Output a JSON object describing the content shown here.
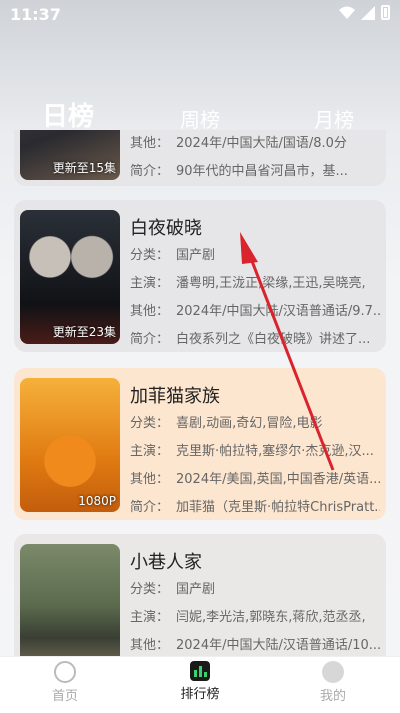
{
  "status": {
    "time": "11:37"
  },
  "tabs": [
    {
      "label": "日榜",
      "active": true
    },
    {
      "label": "周榜",
      "active": false
    },
    {
      "label": "月榜",
      "active": false
    }
  ],
  "cards": [
    {
      "title": "",
      "badge": "更新至15集",
      "rows": [
        {
          "k": "其他：",
          "v": "2024年/中国大陆/国语/8.0分"
        },
        {
          "k": "简介：",
          "v": "90年代的中昌省河昌市，基..."
        }
      ]
    },
    {
      "title": "白夜破晓",
      "badge": "更新至23集",
      "rows": [
        {
          "k": "分类：",
          "v": "国产剧"
        },
        {
          "k": "主演：",
          "v": "潘粤明,王泷正,梁缘,王迅,吴晓亮,"
        },
        {
          "k": "其他：",
          "v": "2024年/中国大陆/汉语普通话/9.7..."
        },
        {
          "k": "简介：",
          "v": "白夜系列之《白夜破晓》讲述了..."
        }
      ]
    },
    {
      "title": "加菲猫家族",
      "badge": "1080P",
      "rows": [
        {
          "k": "分类：",
          "v": "喜剧,动画,奇幻,冒险,电影"
        },
        {
          "k": "主演：",
          "v": "克里斯·帕拉特,塞缪尔·杰克逊,汉..."
        },
        {
          "k": "其他：",
          "v": "2024年/美国,英国,中国香港/英语..."
        },
        {
          "k": "简介：",
          "v": "加菲猫（克里斯·帕拉特ChrisPratt..."
        }
      ]
    },
    {
      "title": "小巷人家",
      "badge": "",
      "rows": [
        {
          "k": "分类：",
          "v": "国产剧"
        },
        {
          "k": "主演：",
          "v": "闫妮,李光洁,郭晓东,蒋欣,范丞丞,"
        },
        {
          "k": "其他：",
          "v": "2024年/中国大陆/汉语普通话/10..."
        }
      ]
    }
  ],
  "nav": [
    {
      "label": "首页",
      "active": false
    },
    {
      "label": "排行榜",
      "active": true
    },
    {
      "label": "我的",
      "active": false
    }
  ],
  "colors": {
    "accent": "#222222",
    "arrow": "#d9232d",
    "peach": "#fde6cf"
  }
}
